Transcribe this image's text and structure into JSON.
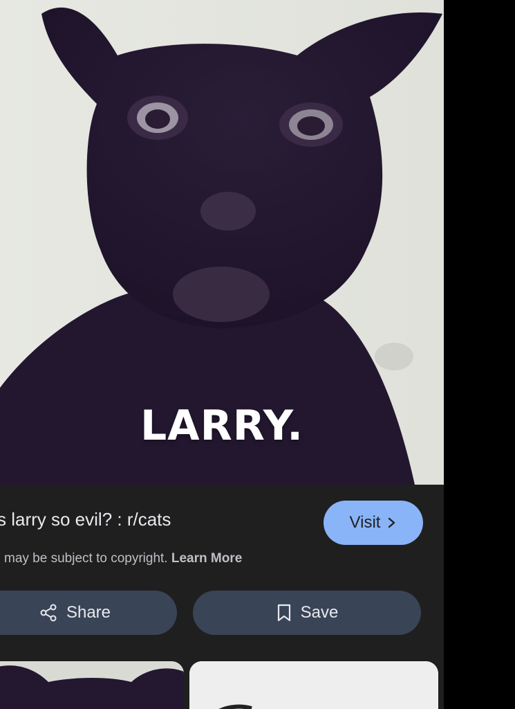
{
  "result": {
    "image_caption": "LARRY.",
    "title": "s larry so evil? : r/cats",
    "visit_label": "Visit",
    "copyright_text": "may be subject to copyright.",
    "learn_more_label": "Learn More",
    "share_label": "Share",
    "save_label": "Save"
  },
  "colors": {
    "panel_bg": "#1f1f1f",
    "visit_bg": "#8ab4f8",
    "pill_bg": "#394457",
    "text_primary": "#e8eaed",
    "text_secondary": "#bdc1c6"
  },
  "icons": {
    "visit": "chevron-right-icon",
    "share": "share-icon",
    "save": "bookmark-icon"
  }
}
